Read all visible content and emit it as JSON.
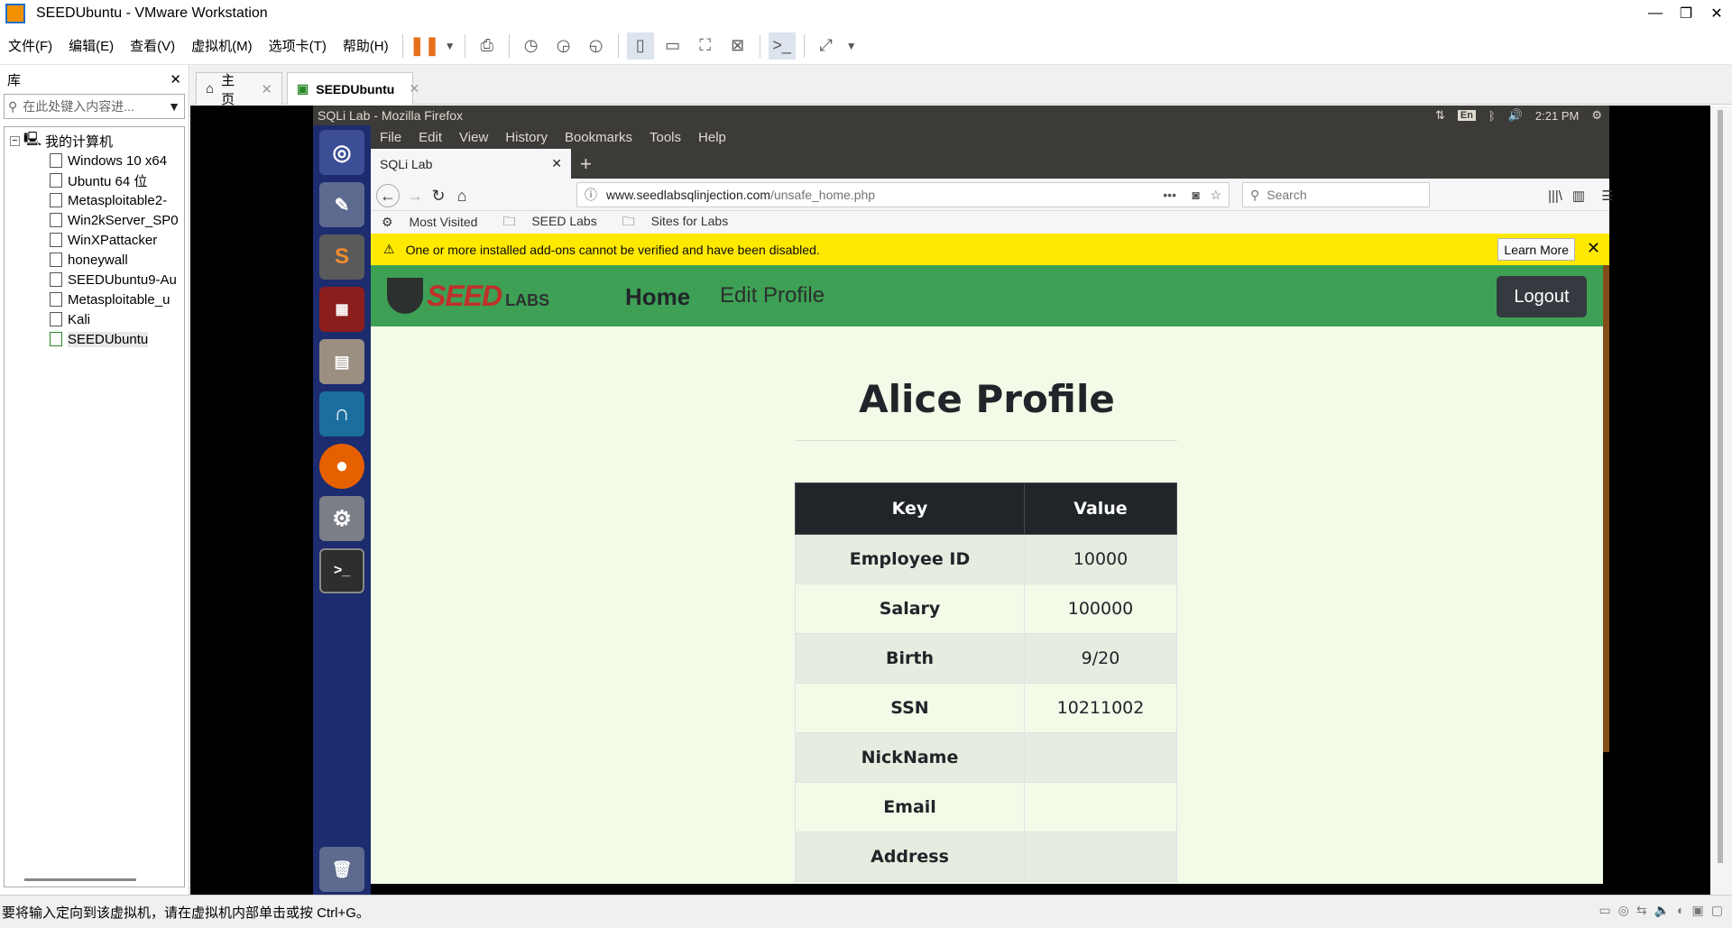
{
  "vmware": {
    "title": "SEEDUbuntu - VMware Workstation",
    "menu": [
      "文件(F)",
      "编辑(E)",
      "查看(V)",
      "虚拟机(M)",
      "选项卡(T)",
      "帮助(H)"
    ],
    "library": {
      "title": "库",
      "search_placeholder": "在此处键入内容进...",
      "root": "我的计算机",
      "items": [
        "Windows 10 x64",
        "Ubuntu 64 位",
        "Metasploitable2-",
        "Win2kServer_SP0",
        "WinXPattacker",
        "honeywall",
        "SEEDUbuntu9-Au",
        "Metasploitable_u",
        "Kali",
        "SEEDUbuntu"
      ],
      "selected": "SEEDUbuntu"
    },
    "tabs": [
      {
        "label": "主页"
      },
      {
        "label": "SEEDUbuntu"
      }
    ],
    "status": "要将输入定向到该虚拟机，请在虚拟机内部单击或按 Ctrl+G。"
  },
  "ubuntu": {
    "window_title": "SQLi Lab - Mozilla Firefox",
    "keyboard": "En",
    "time": "2:21 PM"
  },
  "firefox": {
    "menu": [
      "File",
      "Edit",
      "View",
      "History",
      "Bookmarks",
      "Tools",
      "Help"
    ],
    "tab_title": "SQLi Lab",
    "url_host": "www.seedlabsqlinjection.com",
    "url_path": "/unsafe_home.php",
    "search_placeholder": "Search",
    "bookmarks": [
      "Most Visited",
      "SEED Labs",
      "Sites for Labs"
    ],
    "notice": "One or more installed add-ons cannot be verified and have been disabled.",
    "notice_button": "Learn More"
  },
  "page": {
    "brand_main": "SEED",
    "brand_sub": "LABS",
    "nav_home": "Home",
    "nav_edit": "Edit Profile",
    "logout": "Logout",
    "title": "Alice Profile",
    "table_headers": [
      "Key",
      "Value"
    ],
    "rows": [
      {
        "key": "Employee ID",
        "value": "10000"
      },
      {
        "key": "Salary",
        "value": "100000"
      },
      {
        "key": "Birth",
        "value": "9/20"
      },
      {
        "key": "SSN",
        "value": "10211002"
      },
      {
        "key": "NickName",
        "value": ""
      },
      {
        "key": "Email",
        "value": ""
      },
      {
        "key": "Address",
        "value": ""
      }
    ]
  },
  "colors": {
    "navbar": "#3ea055",
    "page_bg": "#f2fbe8",
    "notice_bg": "#ffe900",
    "launcher": "#1d2c6e",
    "table_head": "#212529"
  }
}
